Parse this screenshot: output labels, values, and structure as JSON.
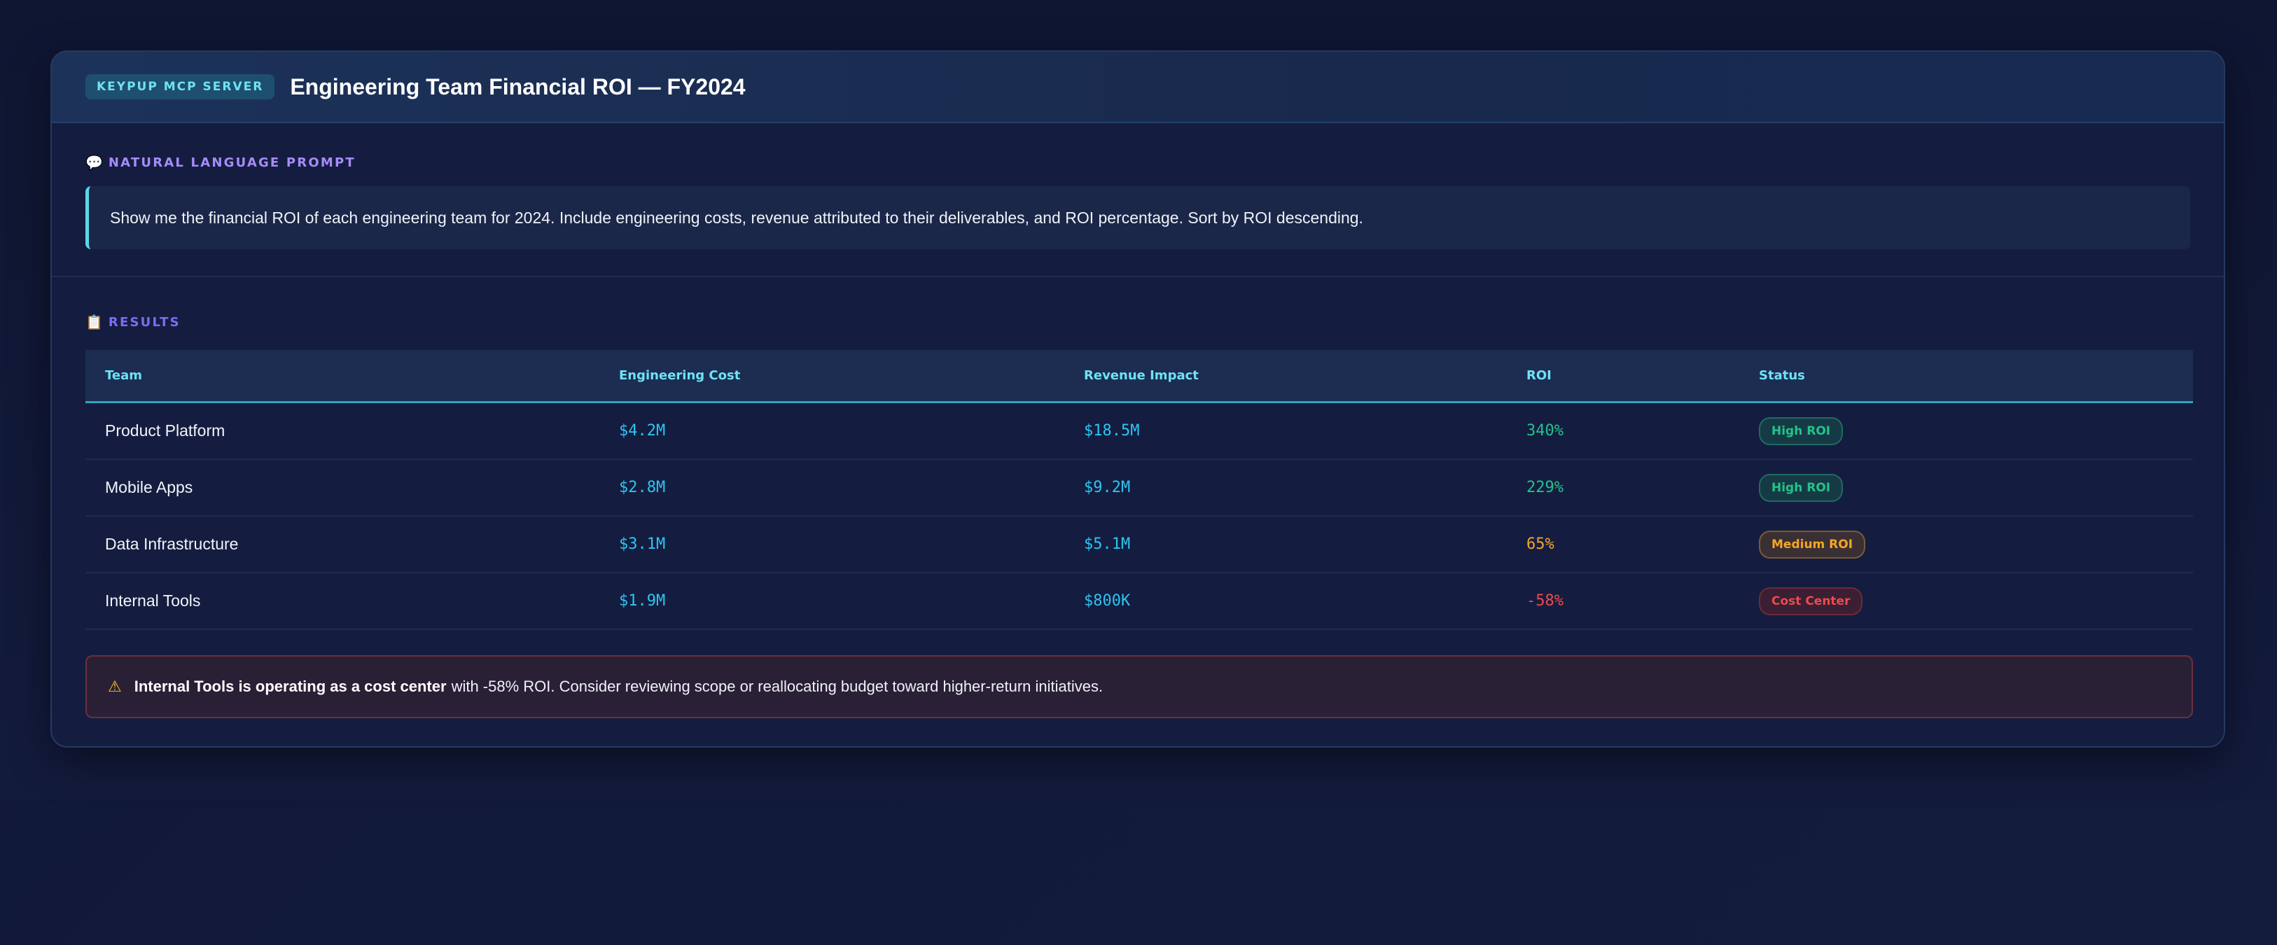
{
  "header": {
    "badge": "KEYPUP MCP SERVER",
    "title": "Engineering Team Financial ROI — FY2024"
  },
  "prompt": {
    "icon": "speech-bubble-icon",
    "label": "NATURAL LANGUAGE PROMPT",
    "text": "Show me the financial ROI of each engineering team for 2024. Include engineering costs, revenue attributed to their deliverables, and ROI percentage. Sort by ROI descending."
  },
  "results": {
    "icon": "clipboard-icon",
    "label": "RESULTS",
    "columns": [
      "Team",
      "Engineering Cost",
      "Revenue Impact",
      "ROI",
      "Status"
    ],
    "rows": [
      {
        "team": "Product Platform",
        "cost": "$4.2M",
        "revenue": "$18.5M",
        "roi": "340%",
        "status": "High ROI",
        "level": "high"
      },
      {
        "team": "Mobile Apps",
        "cost": "$2.8M",
        "revenue": "$9.2M",
        "roi": "229%",
        "status": "High ROI",
        "level": "high"
      },
      {
        "team": "Data Infrastructure",
        "cost": "$3.1M",
        "revenue": "$5.1M",
        "roi": "65%",
        "status": "Medium ROI",
        "level": "medium"
      },
      {
        "team": "Internal Tools",
        "cost": "$1.9M",
        "revenue": "$800K",
        "roi": "-58%",
        "status": "Cost Center",
        "level": "low"
      }
    ]
  },
  "alert": {
    "icon": "warning-icon",
    "bold": "Internal Tools is operating as a cost center",
    "text": "with -58% ROI. Consider reviewing scope or reallocating budget toward higher-return initiatives."
  },
  "colors": {
    "accent_cyan": "#6ee2f5",
    "high": "#22c38a",
    "medium": "#f5a623",
    "low": "#ef4a4a",
    "money": "#2ec4f2"
  }
}
